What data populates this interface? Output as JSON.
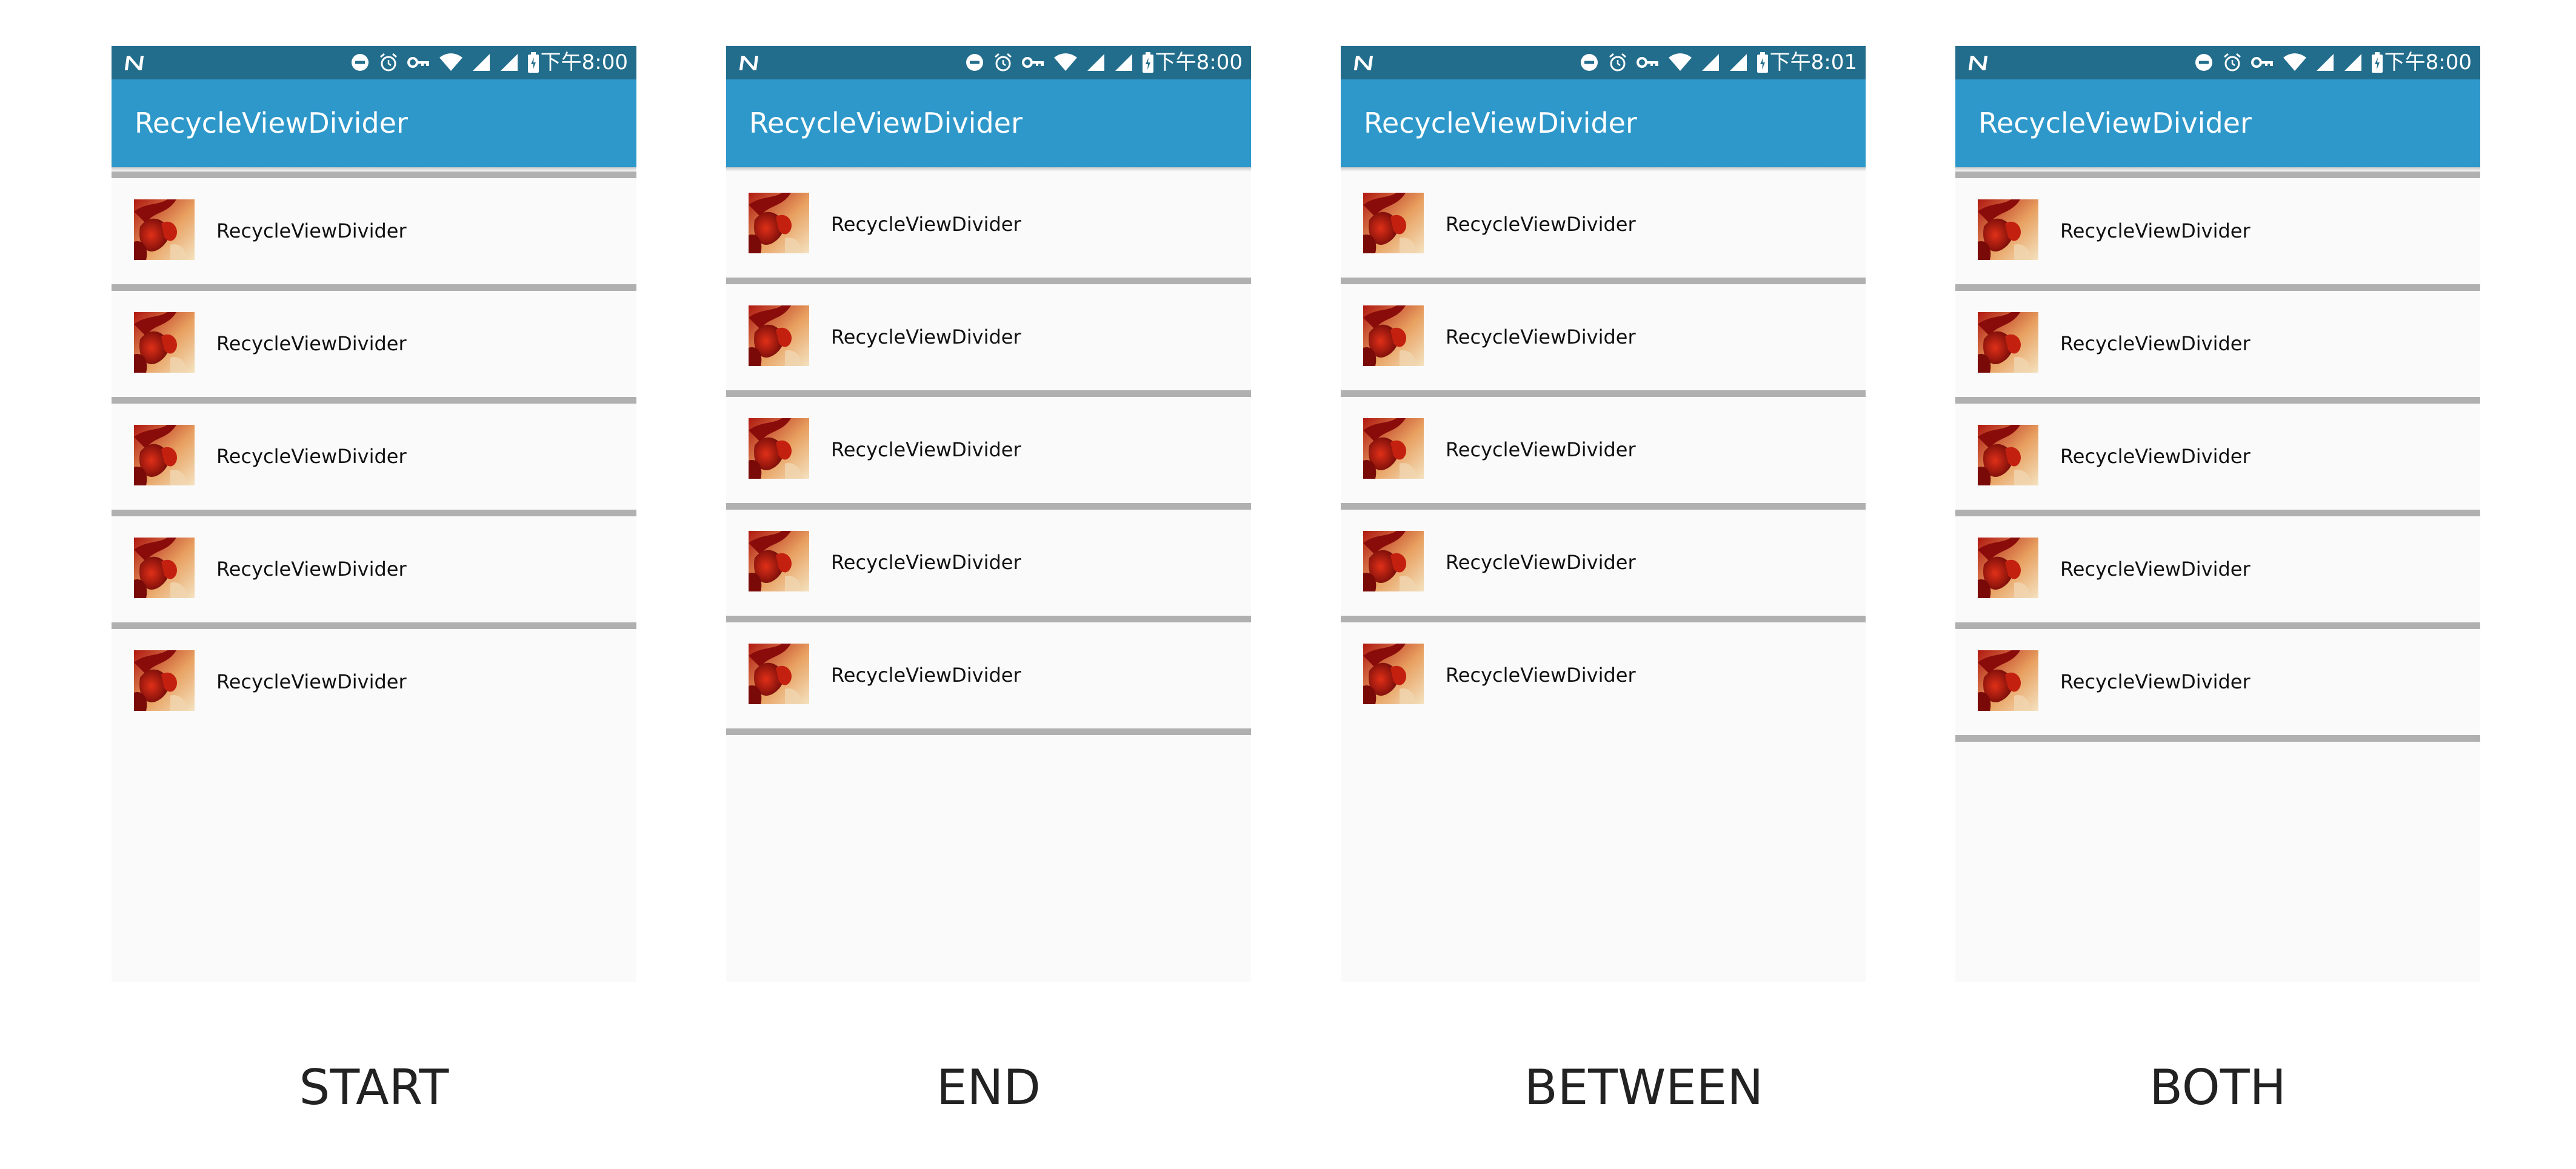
{
  "panels": [
    {
      "mode": "START",
      "status_time": "下午8:00",
      "app_title": "RecycleViewDivider",
      "items": [
        "RecycleViewDivider",
        "RecycleViewDivider",
        "RecycleViewDivider",
        "RecycleViewDivider",
        "RecycleViewDivider"
      ]
    },
    {
      "mode": "END",
      "status_time": "下午8:00",
      "app_title": "RecycleViewDivider",
      "items": [
        "RecycleViewDivider",
        "RecycleViewDivider",
        "RecycleViewDivider",
        "RecycleViewDivider",
        "RecycleViewDivider"
      ]
    },
    {
      "mode": "BETWEEN",
      "status_time": "下午8:01",
      "app_title": "RecycleViewDivider",
      "items": [
        "RecycleViewDivider",
        "RecycleViewDivider",
        "RecycleViewDivider",
        "RecycleViewDivider",
        "RecycleViewDivider"
      ]
    },
    {
      "mode": "BOTH",
      "status_time": "下午8:00",
      "app_title": "RecycleViewDivider",
      "items": [
        "RecycleViewDivider",
        "RecycleViewDivider",
        "RecycleViewDivider",
        "RecycleViewDivider",
        "RecycleViewDivider"
      ]
    }
  ],
  "status_icons": [
    "n-notification-icon",
    "do-not-disturb-icon",
    "alarm-icon",
    "vpn-key-icon",
    "wifi-icon",
    "signal-icon",
    "signal-icon",
    "battery-icon"
  ],
  "colors": {
    "status_bar": "#226d8c",
    "app_bar": "#2e98ca",
    "background": "#fafafa",
    "divider": "#b0b0b0",
    "caption": "#222222"
  }
}
